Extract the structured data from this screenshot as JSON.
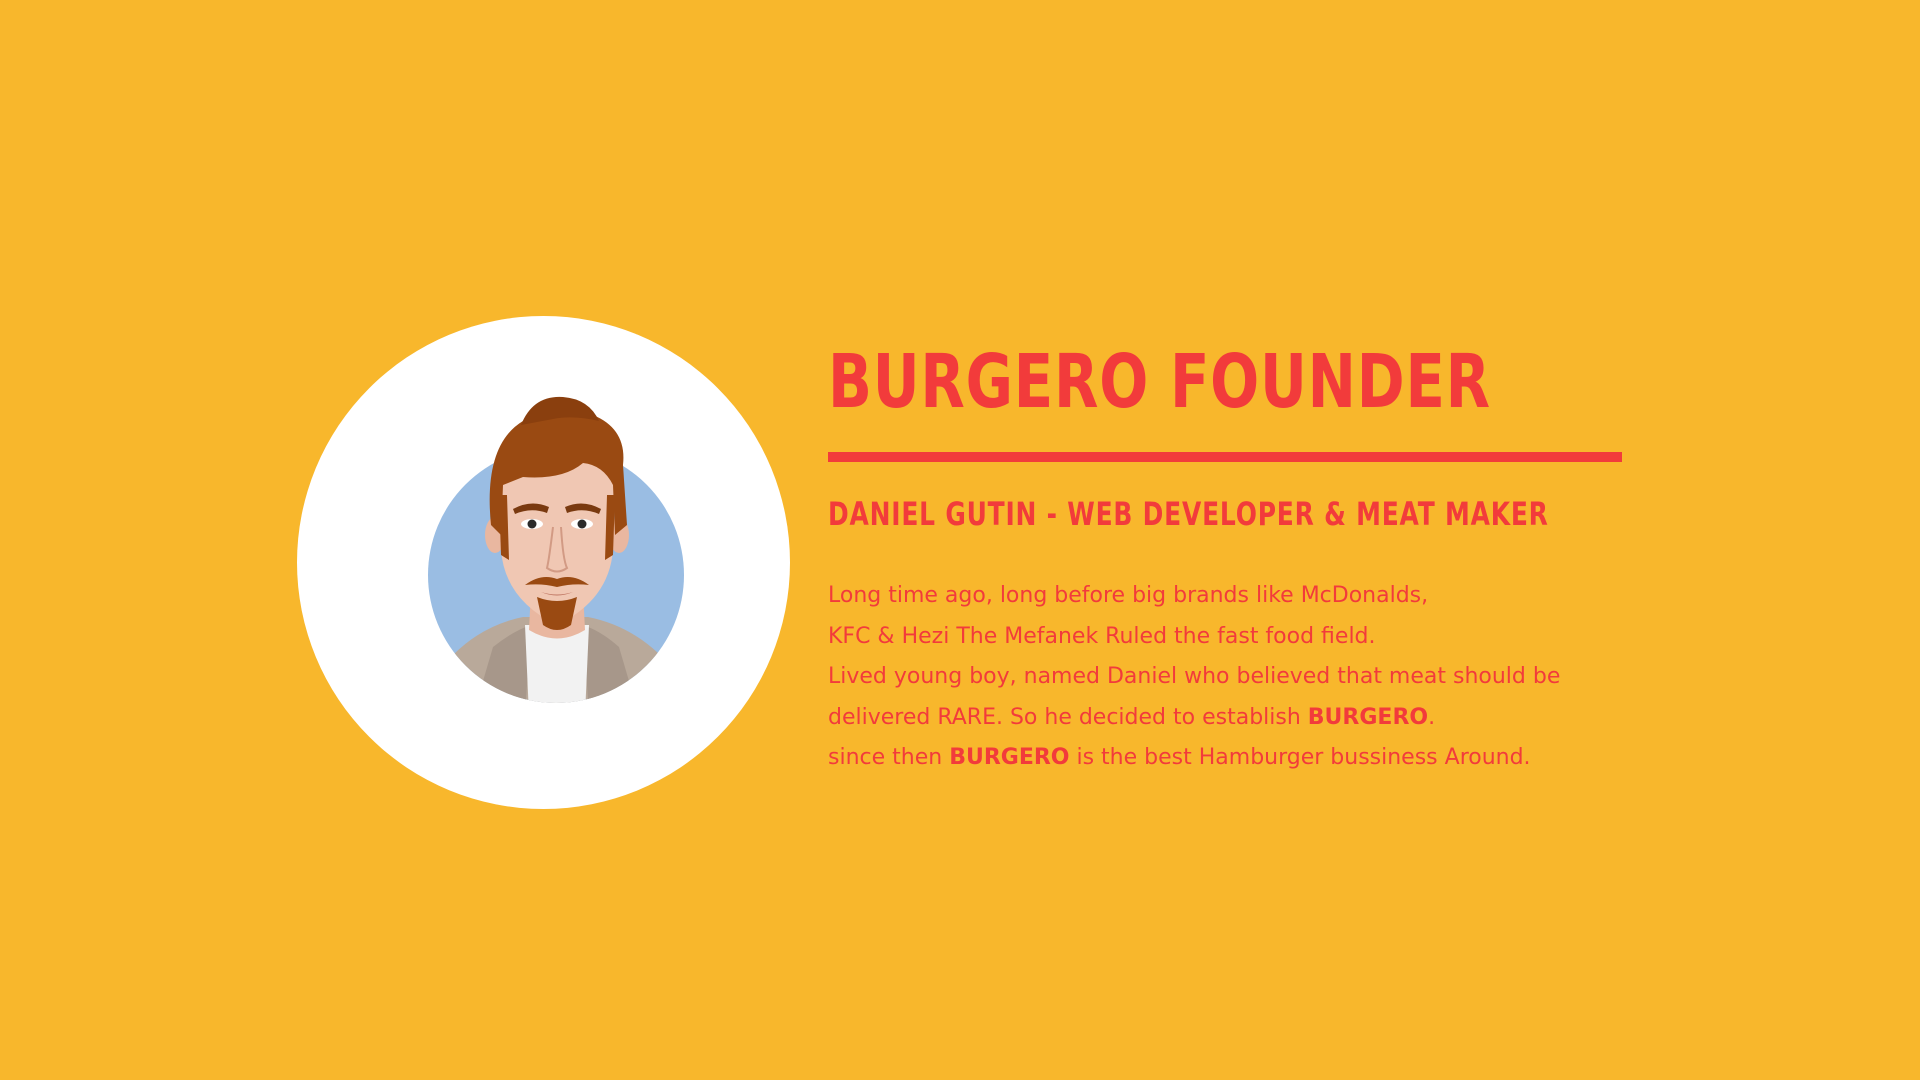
{
  "colors": {
    "background": "#F8B72C",
    "accent": "#F23B3B",
    "avatar_bg": "#FFFFFF"
  },
  "founder": {
    "avatar_icon": "founder-portrait-illustration",
    "title": "BURGERO FOUNDER",
    "subtitle": "DANIEL GUTIN - WEB DEVELOPER & MEAT MAKER",
    "story": {
      "line1": "Long time ago, long before big brands like McDonalds,",
      "line2": "KFC & Hezi The Mefanek Ruled the fast food field.",
      "line3": "Lived young boy, named Daniel who believed that meat should be",
      "line4_pre": "delivered RARE. So he decided to establish ",
      "line4_brand": "BURGERO",
      "line4_post": ".",
      "line5_pre": "since then ",
      "line5_brand": "BURGERO",
      "line5_post": " is the best Hamburger bussiness Around."
    }
  }
}
